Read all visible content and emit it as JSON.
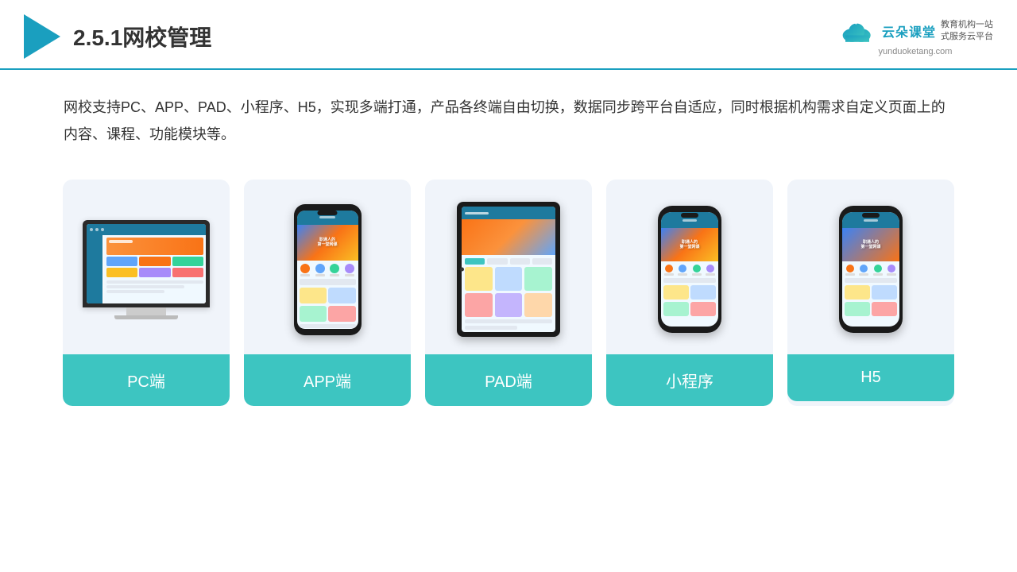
{
  "header": {
    "title": "2.5.1网校管理",
    "logo_text_cn": "云朵课堂",
    "logo_url": "yunduoketang.com",
    "logo_slogan": "教育机构一站\n式服务云平台"
  },
  "description": {
    "text": "网校支持PC、APP、PAD、小程序、H5，实现多端打通，产品各终端自由切换，数据同步跨平台自适应，同时根据机构需求自定义页面上的内容、课程、功能模块等。"
  },
  "cards": [
    {
      "id": "pc",
      "label": "PC端"
    },
    {
      "id": "app",
      "label": "APP端"
    },
    {
      "id": "pad",
      "label": "PAD端"
    },
    {
      "id": "miniapp",
      "label": "小程序"
    },
    {
      "id": "h5",
      "label": "H5"
    }
  ],
  "colors": {
    "accent": "#3dc5c1",
    "header_line": "#1a9fbf",
    "text_primary": "#333333"
  }
}
